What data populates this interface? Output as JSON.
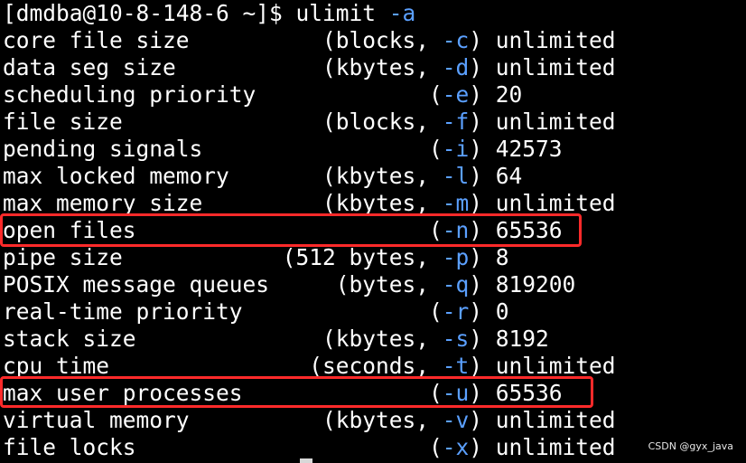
{
  "terminal": {
    "prompt": "[dmdba@10-8-148-6 ~]$ ulimit ",
    "command_flag": "-a",
    "rows": [
      {
        "name": "core file size          ",
        "unit": "(blocks, ",
        "flag": "-c",
        "value": ") unlimited"
      },
      {
        "name": "data seg size           ",
        "unit": "(kbytes, ",
        "flag": "-d",
        "value": ") unlimited"
      },
      {
        "name": "scheduling priority             ",
        "unit": "(",
        "flag": "-e",
        "value": ") 20"
      },
      {
        "name": "file size               ",
        "unit": "(blocks, ",
        "flag": "-f",
        "value": ") unlimited"
      },
      {
        "name": "pending signals                 ",
        "unit": "(",
        "flag": "-i",
        "value": ") 42573"
      },
      {
        "name": "max locked memory       ",
        "unit": "(kbytes, ",
        "flag": "-l",
        "value": ") 64"
      },
      {
        "name": "max memory size         ",
        "unit": "(kbytes, ",
        "flag": "-m",
        "value": ") unlimited"
      },
      {
        "name": "open files                      ",
        "unit": "(",
        "flag": "-n",
        "value": ") 65536"
      },
      {
        "name": "pipe size            ",
        "unit": "(512 bytes, ",
        "flag": "-p",
        "value": ") 8"
      },
      {
        "name": "POSIX message queues     ",
        "unit": "(bytes, ",
        "flag": "-q",
        "value": ") 819200"
      },
      {
        "name": "real-time priority              ",
        "unit": "(",
        "flag": "-r",
        "value": ") 0"
      },
      {
        "name": "stack size              ",
        "unit": "(kbytes, ",
        "flag": "-s",
        "value": ") 8192"
      },
      {
        "name": "cpu time               ",
        "unit": "(seconds, ",
        "flag": "-t",
        "value": ") unlimited"
      },
      {
        "name": "max user processes              ",
        "unit": "(",
        "flag": "-u",
        "value": ") 65536"
      },
      {
        "name": "virtual memory          ",
        "unit": "(kbytes, ",
        "flag": "-v",
        "value": ") unlimited"
      },
      {
        "name": "file locks                      ",
        "unit": "(",
        "flag": "-x",
        "value": ") unlimited"
      }
    ]
  },
  "annotations": {
    "highlight_color": "#ff2a2a",
    "highlighted_rows": [
      "open files",
      "max user processes"
    ]
  },
  "watermark": "CSDN @gyx_java",
  "colors": {
    "background": "#000000",
    "text": "#ffffff",
    "flag": "#5ba0ff"
  }
}
